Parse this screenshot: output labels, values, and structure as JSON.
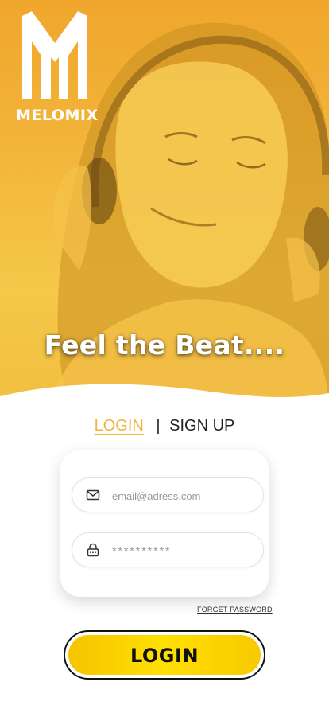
{
  "hero": {
    "brand": "MELOMIX",
    "tagline": "Feel the Beat....",
    "overlay_color": "#f2b33d"
  },
  "tabs": {
    "login": "LOGIN",
    "separator": "|",
    "signup": "SIGN UP",
    "active": "login",
    "active_color": "#f2b33d"
  },
  "form": {
    "email_placeholder": "email@adress.com",
    "email_icon": "mail-icon",
    "password_placeholder": "**********",
    "password_icon": "lock-icon"
  },
  "forgot_password": "FORGET PASSWORD",
  "login_button": {
    "label": "LOGIN",
    "color": "#ffd800"
  }
}
